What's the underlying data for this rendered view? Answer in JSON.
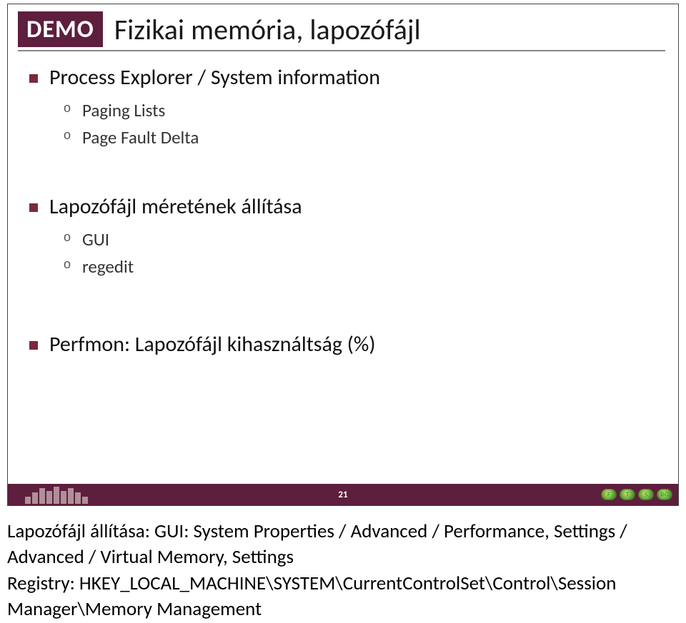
{
  "slide": {
    "badge": "DEMO",
    "title": "Fizikai memória, lapozófájl",
    "bullets": [
      {
        "text": "Process Explorer / System information",
        "subs": [
          "Paging Lists",
          "Page Fault Delta"
        ]
      },
      {
        "text": "Lapozófájl méretének állítása",
        "subs": [
          "GUI",
          "regedit"
        ]
      },
      {
        "text": "Perfmon: Lapozófájl kihasználtság (%)",
        "subs": []
      }
    ],
    "page": "21",
    "badges": [
      "F",
      "T",
      "S",
      "RG"
    ]
  },
  "notes": {
    "line1": "Lapozófájl állítása: GUI: System Properties / Advanced / Performance, Settings / Advanced / Virtual Memory, Settings",
    "line2": "Registry: HKEY_LOCAL_MACHINE\\SYSTEM\\CurrentControlSet\\Control\\Session Manager\\Memory Management"
  }
}
